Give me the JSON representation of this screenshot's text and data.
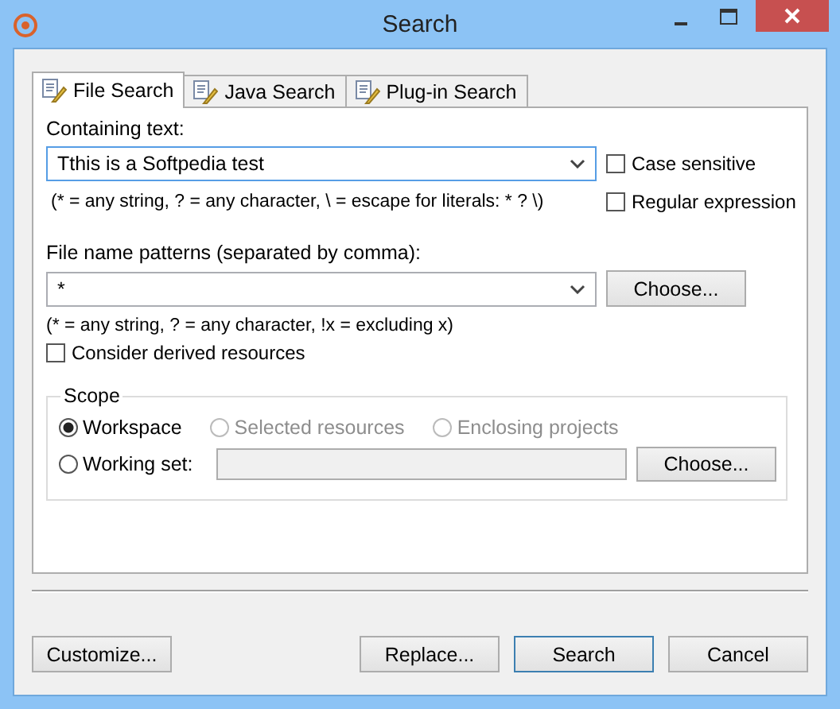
{
  "window": {
    "title": "Search"
  },
  "tabs": [
    {
      "label": "File Search",
      "selected": true
    },
    {
      "label": "Java Search",
      "selected": false
    },
    {
      "label": "Plug-in Search",
      "selected": false
    }
  ],
  "containing_text": {
    "label": "Containing text:",
    "value": "Tthis is a Softpedia test",
    "focused": true,
    "hint": "(* = any string, ? = any character, \\ = escape for literals: * ? \\)"
  },
  "options": [
    {
      "label": "Case sensitive",
      "checked": false
    },
    {
      "label": "Regular expression",
      "checked": false
    }
  ],
  "file_patterns": {
    "label": "File name patterns (separated by comma):",
    "value": "*",
    "button": "Choose...",
    "hint": "(* = any string, ? = any character, !x = excluding x)"
  },
  "derived": {
    "label": "Consider derived resources",
    "checked": false
  },
  "scope": {
    "title": "Scope",
    "options": [
      {
        "label": "Workspace",
        "selected": true,
        "disabled": false
      },
      {
        "label": "Selected resources",
        "selected": false,
        "disabled": true
      },
      {
        "label": "Enclosing projects",
        "selected": false,
        "disabled": true
      },
      {
        "label": "Working set:",
        "selected": false,
        "disabled": false
      }
    ],
    "button": "Choose..."
  },
  "buttons": [
    {
      "label": "Customize...",
      "default": false
    },
    {
      "label": "Replace...",
      "default": false
    },
    {
      "label": "Search",
      "default": true
    },
    {
      "label": "Cancel",
      "default": false
    }
  ]
}
